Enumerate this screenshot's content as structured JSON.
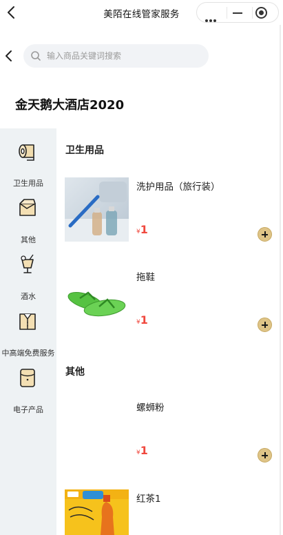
{
  "navbar": {
    "title": "美陌在线管家服务",
    "back_icon": "chevron-left-icon",
    "capsule_icons": [
      "more-dots-icon",
      "minimize-icon",
      "close-target-icon"
    ]
  },
  "search": {
    "placeholder": "输入商品关键词搜索",
    "value": ""
  },
  "hotel": {
    "name": "金天鹅大酒店2020"
  },
  "sidebar": {
    "items": [
      {
        "label": "卫生用品",
        "icon": "toilet-paper-icon"
      },
      {
        "label": "其他",
        "icon": "box-icon"
      },
      {
        "label": "酒水",
        "icon": "drink-icon"
      },
      {
        "label": "中高端免费服务",
        "icon": "shirt-icon"
      },
      {
        "label": "电子产品",
        "icon": "device-icon"
      }
    ]
  },
  "sections": [
    {
      "title": "卫生用品",
      "products": [
        {
          "name": "洗护用品（旅行装）",
          "currency": "¥",
          "price": "1"
        },
        {
          "name": "拖鞋",
          "currency": "¥",
          "price": "1"
        }
      ]
    },
    {
      "title": "其他",
      "products": [
        {
          "name": "螺蛳粉",
          "currency": "¥",
          "price": "1"
        },
        {
          "name": "红茶1",
          "currency": "¥",
          "price": ""
        }
      ]
    }
  ],
  "colors": {
    "accent_price": "#f0483e",
    "add_button": "#dfc487",
    "sidebar_bg": "#eef2f4",
    "search_bg": "#f1f3f6"
  }
}
